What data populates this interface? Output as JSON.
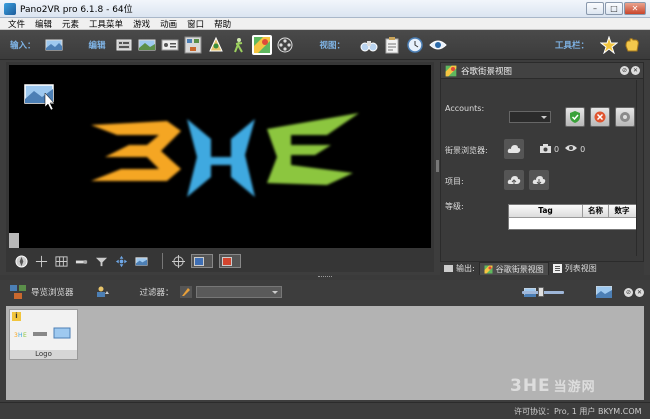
{
  "window": {
    "title": "Pano2VR pro 6.1.8 - 64位",
    "min": "–",
    "max": "□",
    "close": "✕"
  },
  "menu": [
    "文件",
    "编辑",
    "元素",
    "工具菜单",
    "游戏",
    "动画",
    "窗口",
    "帮助"
  ],
  "toolbar": {
    "input_label": "输入：",
    "edit_label": "编辑",
    "view_label": "视图：",
    "tools_label": "工具栏："
  },
  "viewer": {
    "logo_text": "3HE"
  },
  "panel": {
    "title": "谷歌街景视图",
    "accounts_label": "Accounts:",
    "browser_label": "街景浏览器:",
    "photo_count": "0",
    "view_count": "0",
    "project_label": "项目:",
    "level_label": "等级:",
    "table_headers": [
      "Tag",
      "名称",
      "数字"
    ]
  },
  "panel_tabs": [
    "输出:",
    "谷歌街景视图",
    "列表视图"
  ],
  "browser": {
    "title": "导览浏览器",
    "filter_label": "过滤器：",
    "thumb_label": "Logo",
    "thumb_badge": "i"
  },
  "status": {
    "text": "许可协议：Pro, 1 用户 BKYM.COM"
  },
  "watermark": {
    "brand": "3HE",
    "text": "当游网"
  },
  "colors": {
    "accent": "#7fb4e6",
    "orange": "#f5a623",
    "blue": "#3fa9e0",
    "green": "#8cc63f"
  }
}
